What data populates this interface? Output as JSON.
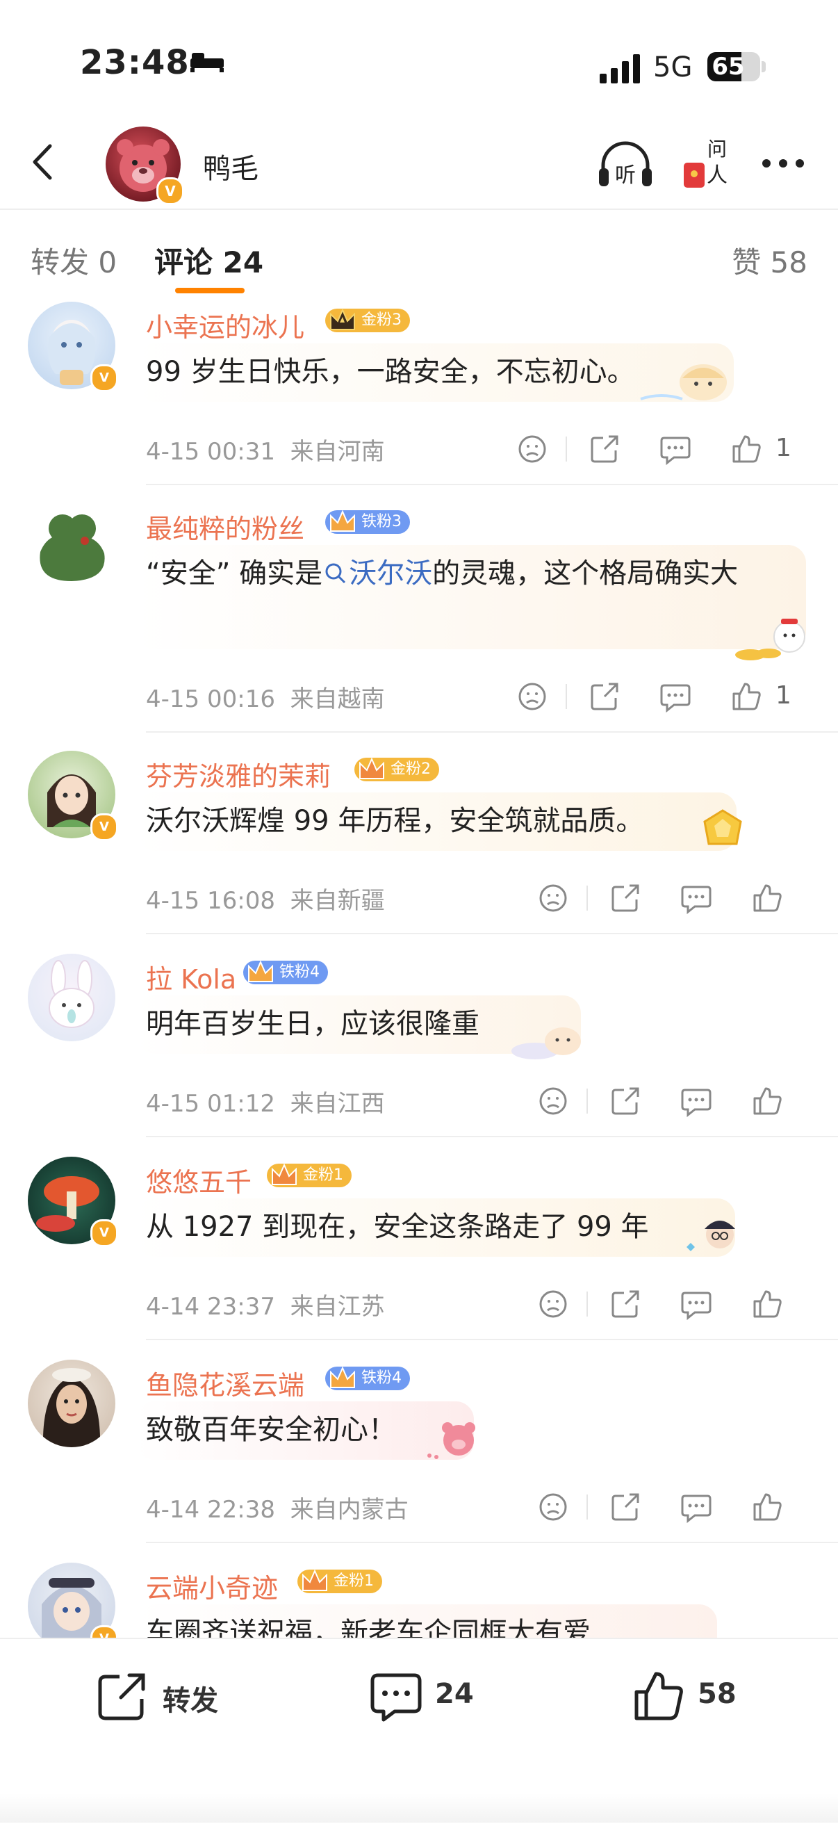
{
  "status_bar": {
    "time": "23:48",
    "network": "5G",
    "battery": "65",
    "battery_level": 0.65
  },
  "nav": {
    "back_icon": "chevron-left-icon",
    "user_name": "鸭毛",
    "listen_icon": "headphones-listen-icon",
    "ask_icon": "ask-person-icon",
    "more_icon": "more-dots-icon"
  },
  "tabs": {
    "repost": "转发 0",
    "comments": "评论 24",
    "likes": "赞 58"
  },
  "comments": [
    {
      "name": "小幸运的冰儿",
      "badge": "金粉3",
      "badge_color": "#f5b83c",
      "text": "99 岁生日快乐，一路安全，不忘初心。",
      "time": "4-15 00:31",
      "location": "来自河南",
      "like_count": "1"
    },
    {
      "name": "最纯粹的粉丝",
      "badge": "铁粉3",
      "badge_color": "#6f9af2",
      "text_before": "“安全” 确实是",
      "topic": "沃尔沃",
      "text_after": "的灵魂，这个格局确实大",
      "time": "4-15 00:16",
      "location": "来自越南",
      "like_count": "1"
    },
    {
      "name": "芬芳淡雅的茉莉",
      "badge": "金粉2",
      "badge_color": "#f5b83c",
      "text": "沃尔沃辉煌 99 年历程，安全筑就品质。",
      "time": "4-15 16:08",
      "location": "来自新疆",
      "like_count": ""
    },
    {
      "name": "拉 Kola",
      "badge": "铁粉4",
      "badge_color": "#6f9af2",
      "text": "明年百岁生日，应该很隆重",
      "time": "4-15 01:12",
      "location": "来自江西",
      "like_count": ""
    },
    {
      "name": "悠悠五千",
      "badge": "金粉1",
      "badge_color": "#f5b83c",
      "text": "从 1927 到现在，安全这条路走了 99 年",
      "time": "4-14 23:37",
      "location": "来自江苏",
      "like_count": ""
    },
    {
      "name": "鱼隐花溪云端",
      "badge": "铁粉4",
      "badge_color": "#6f9af2",
      "text": "致敬百年安全初心！",
      "time": "4-14 22:38",
      "location": "来自内蒙古",
      "like_count": ""
    },
    {
      "name": "云端小奇迹",
      "badge": "金粉1",
      "badge_color": "#f5b83c",
      "text": "车圈齐送祝福，新老车企同框大有爱",
      "time": "",
      "location": "",
      "like_count": ""
    }
  ],
  "bottom_bar": {
    "repost_label": "转发",
    "comment_count": "24",
    "like_count": "58"
  }
}
